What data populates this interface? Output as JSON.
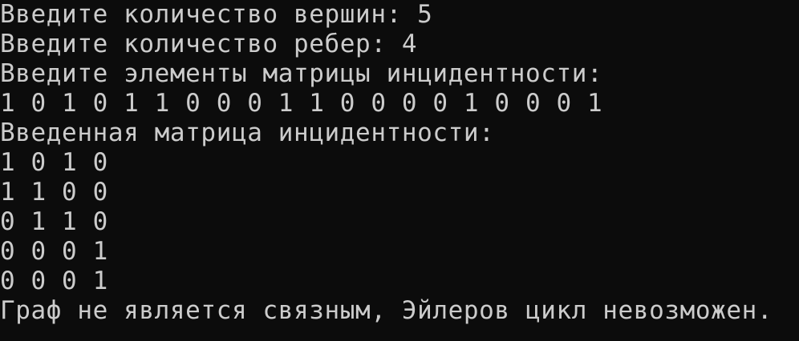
{
  "colors": {
    "background": "#0c0c0c",
    "foreground": "#cccccc"
  },
  "console": {
    "lines": [
      "Введите количество вершин: 5",
      "Введите количество ребер: 4",
      "Введите элементы матрицы инцидентности:",
      "1 0 1 0 1 1 0 0 0 1 1 0 0 0 0 1 0 0 0 1",
      "Введенная матрица инцидентности:",
      "1 0 1 0",
      "1 1 0 0",
      "0 1 1 0",
      "0 0 0 1",
      "0 0 0 1",
      "Граф не является связным, Эйлеров цикл невозможен."
    ]
  }
}
